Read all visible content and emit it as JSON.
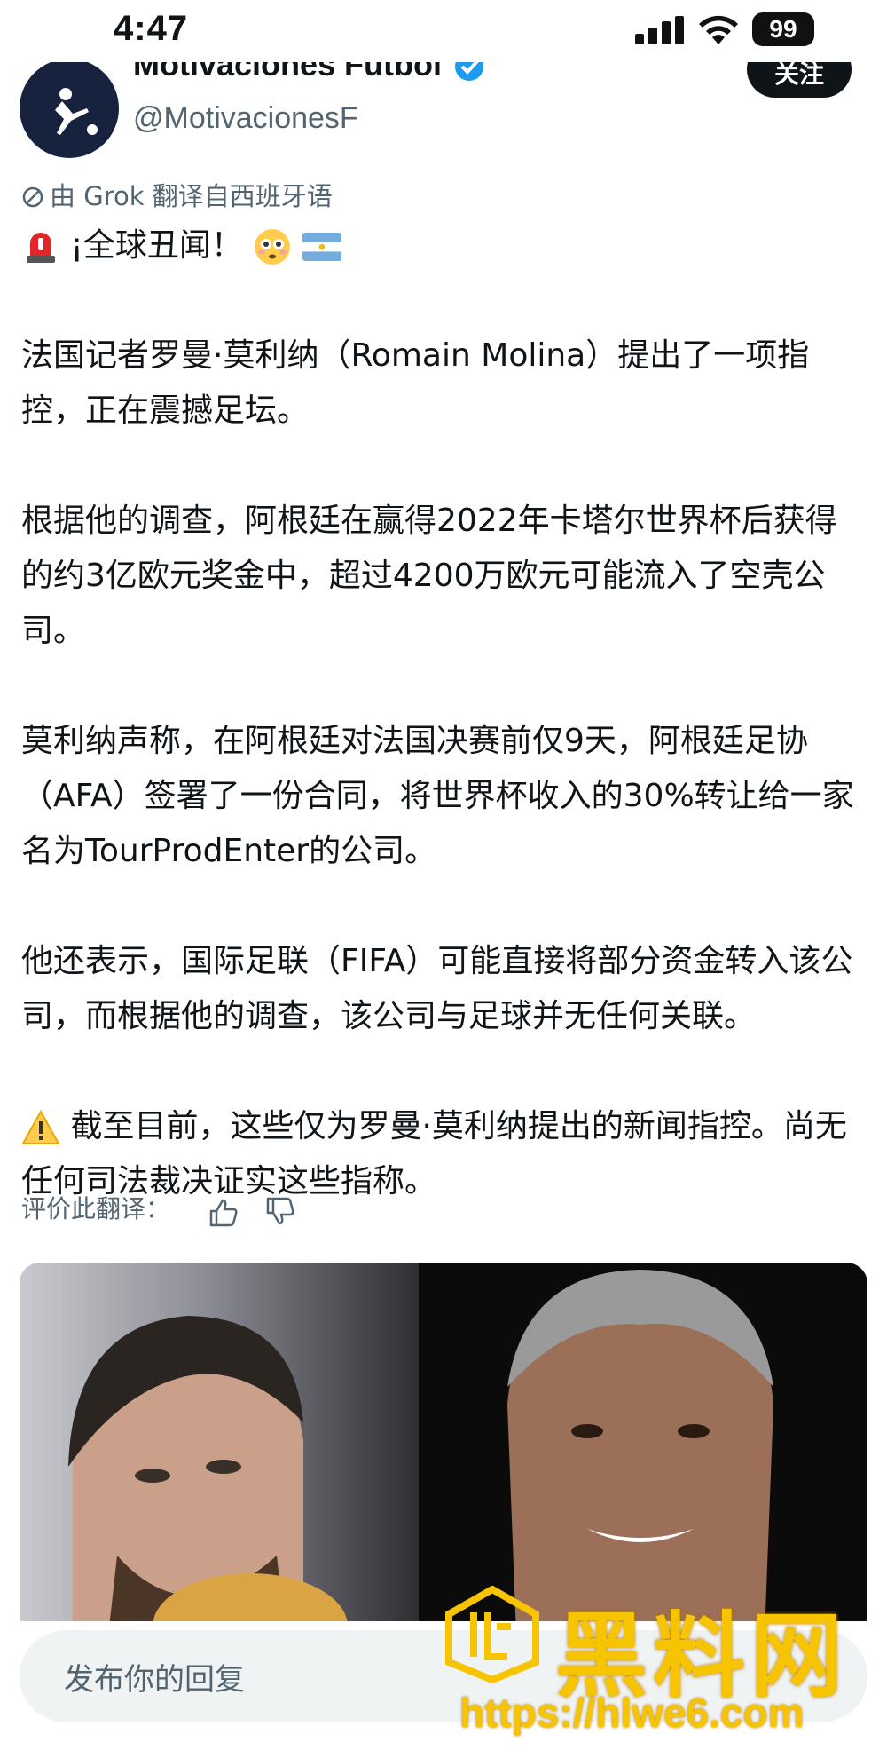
{
  "status_bar": {
    "time": "4:47",
    "battery": "99"
  },
  "header": {
    "display_name": "Motivaciones Futbol",
    "handle": "@MotivacionesF",
    "follow_label": "关注"
  },
  "translation_note": "由 Grok 翻译自西班牙语",
  "post": {
    "headline": "¡全球丑闻！",
    "paragraphs": [
      "法国记者罗曼·莫利纳（Romain Molina）提出了一项指控，正在震撼足坛。",
      "根据他的调查，阿根廷在赢得2022年卡塔尔世界杯后获得的约3亿欧元奖金中，超过4200万欧元可能流入了空壳公司。",
      "莫利纳声称，在阿根廷对法国决赛前仅9天，阿根廷足协（AFA）签署了一份合同，将世界杯收入的30%转让给一家名为TourProdEnter的公司。",
      "他还表示，国际足联（FIFA）可能直接将部分资金转入该公司，而根据他的调查，该公司与足球并无任何关联。"
    ],
    "disclaimer": "截至目前，这些仅为罗曼·莫利纳提出的新闻指控。尚无任何司法裁决证实这些指称。"
  },
  "rate_translation_label": "评价此翻译：",
  "reply_placeholder": "发布你的回复",
  "watermark": {
    "brand": "黑料网",
    "url": "https://hlwe6.com"
  },
  "icons": {
    "signal": "signal-icon",
    "wifi": "wifi-icon",
    "verified": "verified-badge-icon",
    "siren": "siren-emoji-icon",
    "flushed": "flushed-face-emoji-icon",
    "flag": "argentina-flag-icon",
    "warning": "warning-emoji-icon",
    "thumb_up": "thumb-up-icon",
    "thumb_down": "thumb-down-icon"
  },
  "colors": {
    "text": "#0f1419",
    "secondary": "#536471",
    "verified_blue": "#1d9bf0",
    "watermark_yellow": "#f6c400"
  }
}
